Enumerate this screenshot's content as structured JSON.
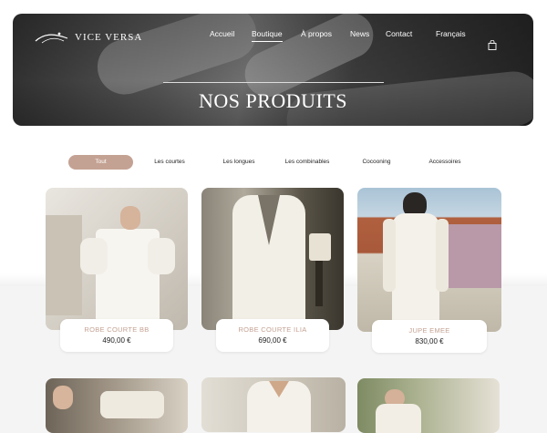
{
  "header": {
    "logo_text": "VICE VERSA",
    "nav": [
      {
        "label": "Accueil",
        "active": false
      },
      {
        "label": "Boutique",
        "active": true
      },
      {
        "label": "À propos",
        "active": false
      },
      {
        "label": "News",
        "active": false
      },
      {
        "label": "Contact",
        "active": false
      },
      {
        "label": "Français",
        "active": false
      }
    ],
    "cart_icon": "shopping-bag-icon"
  },
  "hero": {
    "title": "NOS PRODUITS"
  },
  "filters": [
    {
      "label": "Tout",
      "active": true
    },
    {
      "label": "Les courtes",
      "active": false
    },
    {
      "label": "Les longues",
      "active": false
    },
    {
      "label": "Les combinables",
      "active": false
    },
    {
      "label": "Cocooning",
      "active": false
    },
    {
      "label": "Accessoires",
      "active": false
    }
  ],
  "products": [
    {
      "name": "ROBE COURTE BB",
      "price": "490,00 €"
    },
    {
      "name": "ROBE COURTE ILIA",
      "price": "690,00 €"
    },
    {
      "name": "JUPE EMEE",
      "price": "830,00 €"
    }
  ],
  "colors": {
    "accent": "#c4a293",
    "hero_dark": "#2a2a2a"
  }
}
